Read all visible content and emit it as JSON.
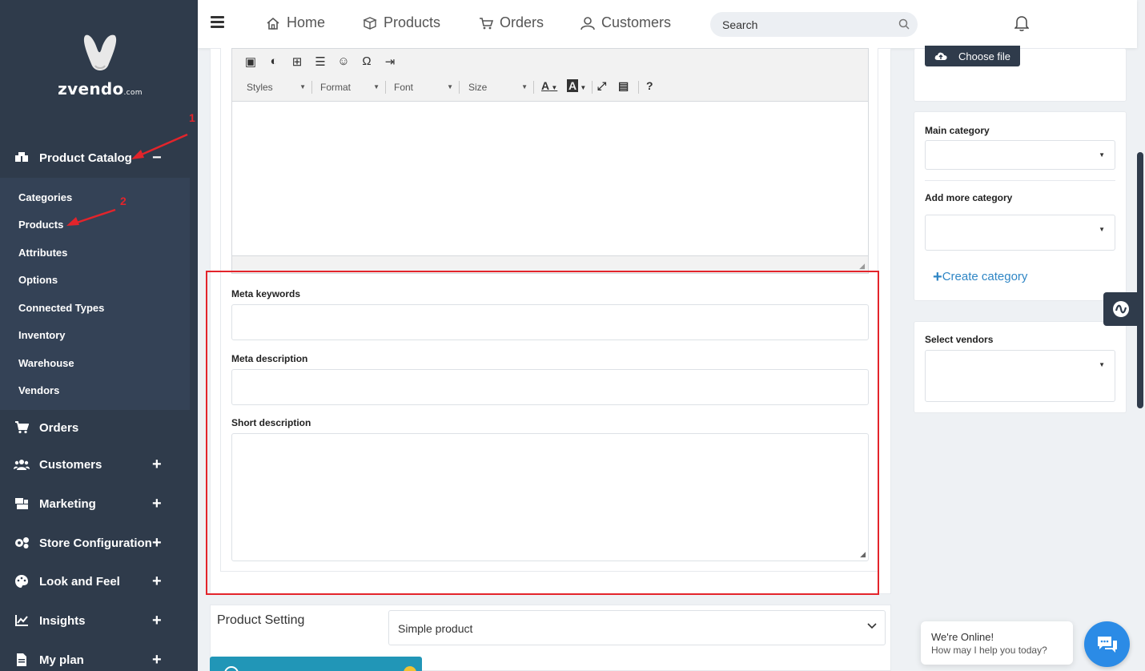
{
  "brand": {
    "name": "zvendo",
    "suffix": ".com"
  },
  "sidebar": {
    "product_catalog": "Product Catalog",
    "submenu": [
      "Categories",
      "Products",
      "Attributes",
      "Options",
      "Connected Types",
      "Inventory",
      "Warehouse",
      "Vendors"
    ],
    "items": [
      {
        "label": "Orders",
        "icon": "cart-icon"
      },
      {
        "label": "Customers",
        "icon": "users-icon"
      },
      {
        "label": "Marketing",
        "icon": "marketing-icon"
      },
      {
        "label": "Store Configuration",
        "icon": "gears-icon"
      },
      {
        "label": "Look and Feel",
        "icon": "palette-icon"
      },
      {
        "label": "Insights",
        "icon": "chart-line-icon"
      },
      {
        "label": "My plan",
        "icon": "document-icon"
      }
    ]
  },
  "topbar": {
    "nav": [
      "Home",
      "Products",
      "Orders",
      "Customers"
    ],
    "search_placeholder": "Search"
  },
  "editor": {
    "styles": "Styles",
    "format": "Format",
    "font": "Font",
    "size": "Size"
  },
  "fields": {
    "meta_keywords": "Meta keywords",
    "meta_description": "Meta description",
    "short_description": "Short description"
  },
  "product_setting": {
    "label": "Product Setting",
    "selected": "Simple product"
  },
  "right": {
    "choose_file": "Choose file",
    "main_category": "Main category",
    "add_more_category": "Add more category",
    "create_category": "Create category",
    "select_vendors": "Select vendors"
  },
  "chat": {
    "line1": "We're Online!",
    "line2": "How may I help you today?"
  },
  "annotations": {
    "step1": "1",
    "step2": "2"
  },
  "colors": {
    "sidebar": "#2f3b4b",
    "accent_red": "#e3242b",
    "link_blue": "#2f86c5",
    "chat_blue": "#2b8be6"
  }
}
